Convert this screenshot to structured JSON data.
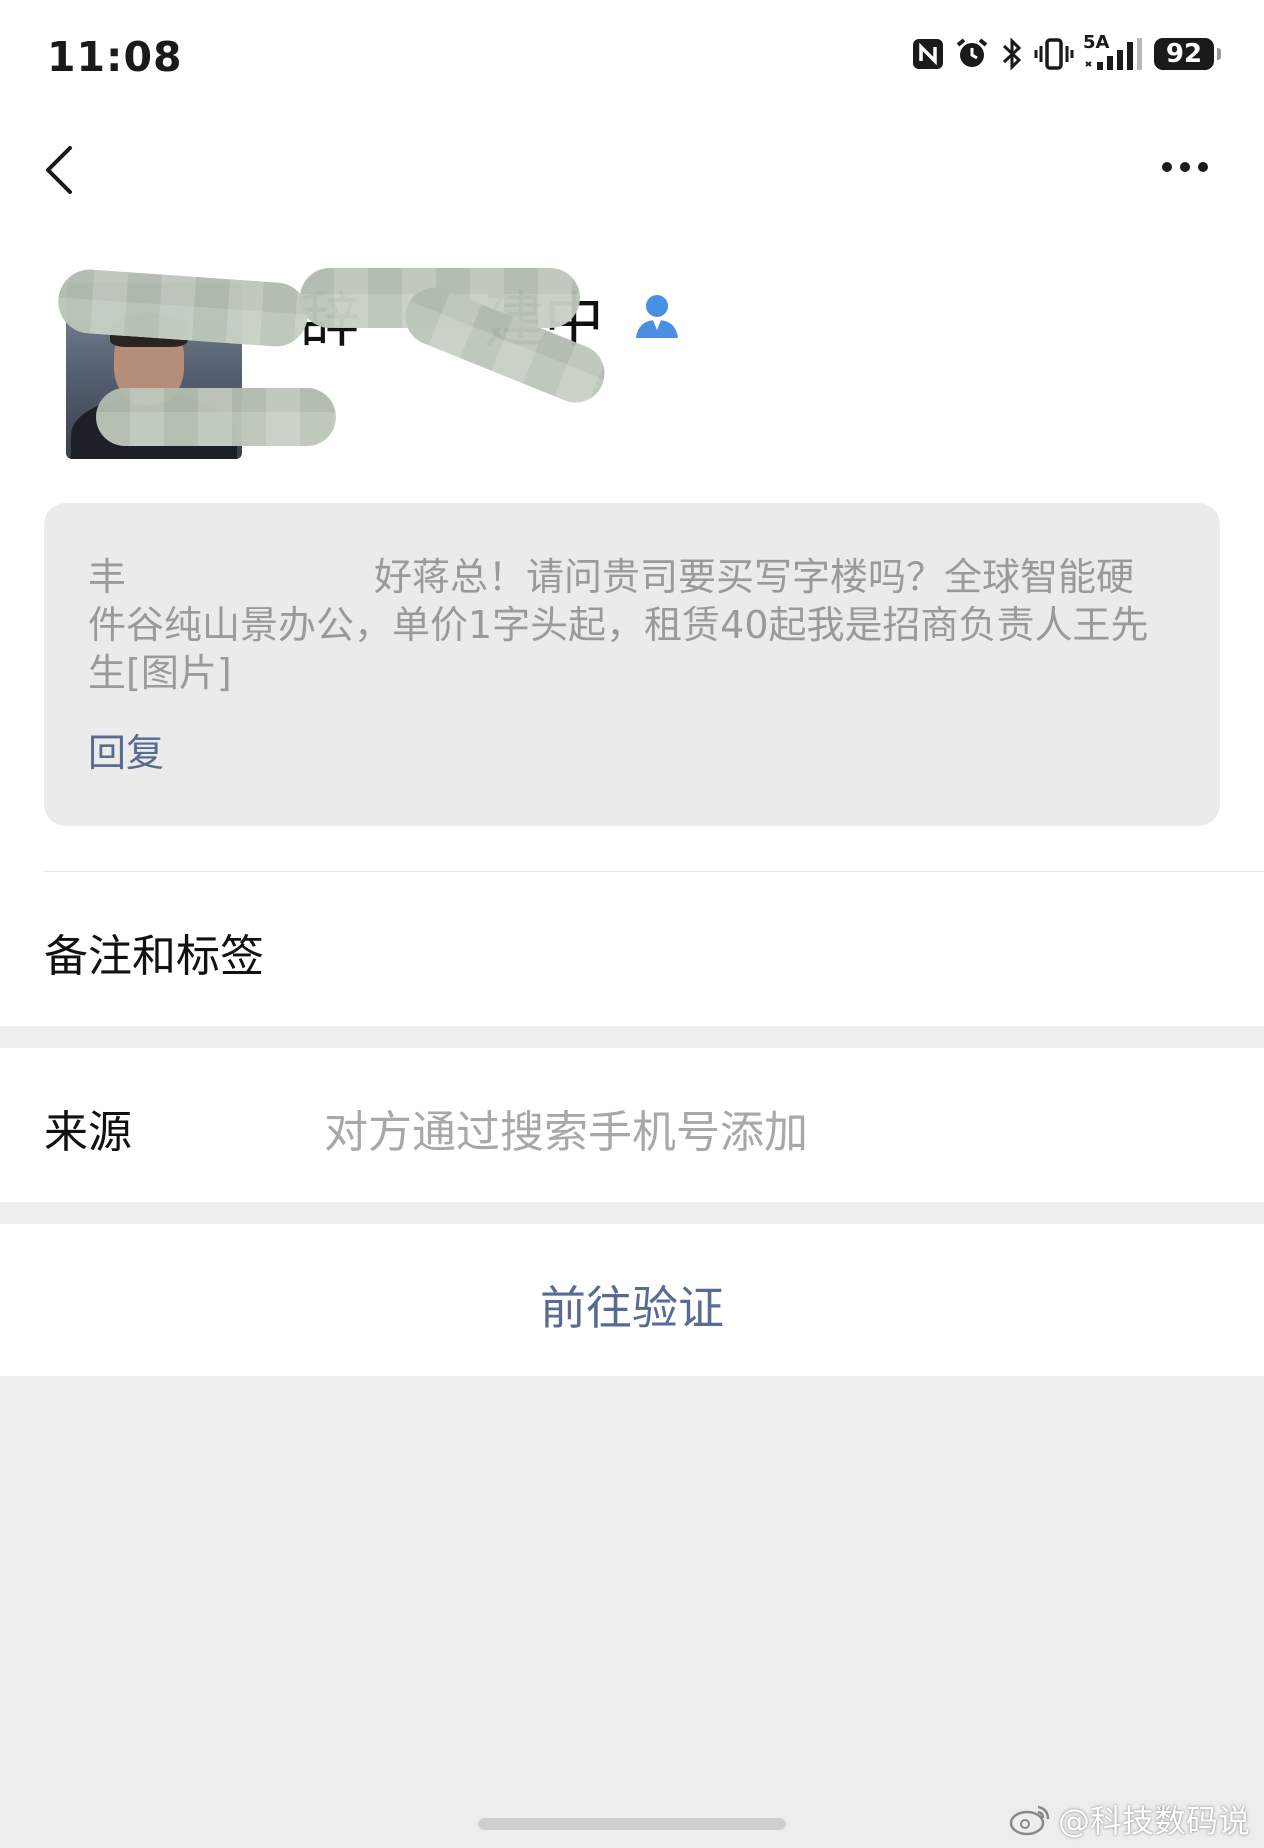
{
  "status_bar": {
    "time": "11:08",
    "network_label": "5A",
    "battery": "92"
  },
  "header": {
    "back_icon": "chevron-left-icon",
    "more_icon": "ellipsis-icon"
  },
  "profile": {
    "name_visible_fragment_1": "辞",
    "name_visible_fragment_2": "建中",
    "contact_icon": "person-icon",
    "contact_icon_color": "#4a90e2"
  },
  "greeting": {
    "prefix": "丰",
    "message": "好蒋总！请问贵司要买写字楼吗？全球智能硬件谷纯山景办公，单价1字头起，租赁40起我是招商负责人王先生[图片]",
    "reply_label": "回复"
  },
  "notes_row": {
    "label": "备注和标签"
  },
  "source_row": {
    "label": "来源",
    "value": "对方通过搜索手机号添加"
  },
  "verify": {
    "label": "前往验证"
  },
  "watermark": {
    "text": "@科技数码说",
    "icon": "weibo-icon"
  },
  "colors": {
    "link": "#576b95",
    "background": "#ededed",
    "card": "#ebebeb"
  }
}
